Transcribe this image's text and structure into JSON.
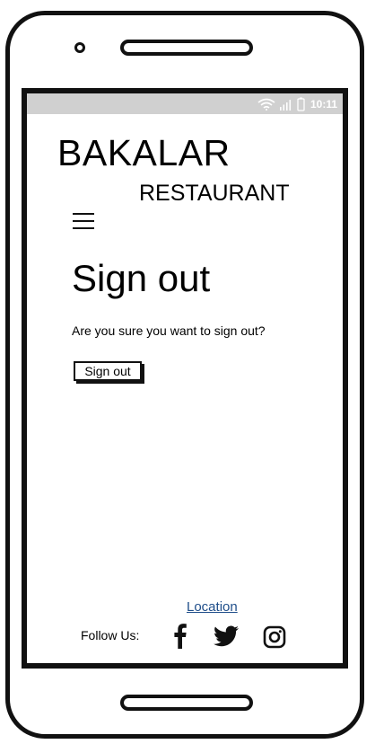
{
  "status_bar": {
    "time": "10:11",
    "icons": [
      "wifi-icon",
      "signal-icon",
      "battery-icon"
    ]
  },
  "brand": {
    "name": "BAKALAR",
    "subtitle": "RESTAURANT"
  },
  "nav": {
    "menu_icon": "hamburger-menu-icon"
  },
  "main": {
    "title": "Sign out",
    "message": "Are you sure you want to sign out?",
    "signout_button": "Sign out"
  },
  "footer": {
    "location_link": "Location",
    "follow_label": "Follow Us:",
    "social": [
      "facebook-icon",
      "twitter-icon",
      "instagram-icon"
    ]
  },
  "colors": {
    "status_bar": "#d0d0d0",
    "link": "#1f4e8a",
    "ink": "#111111"
  }
}
